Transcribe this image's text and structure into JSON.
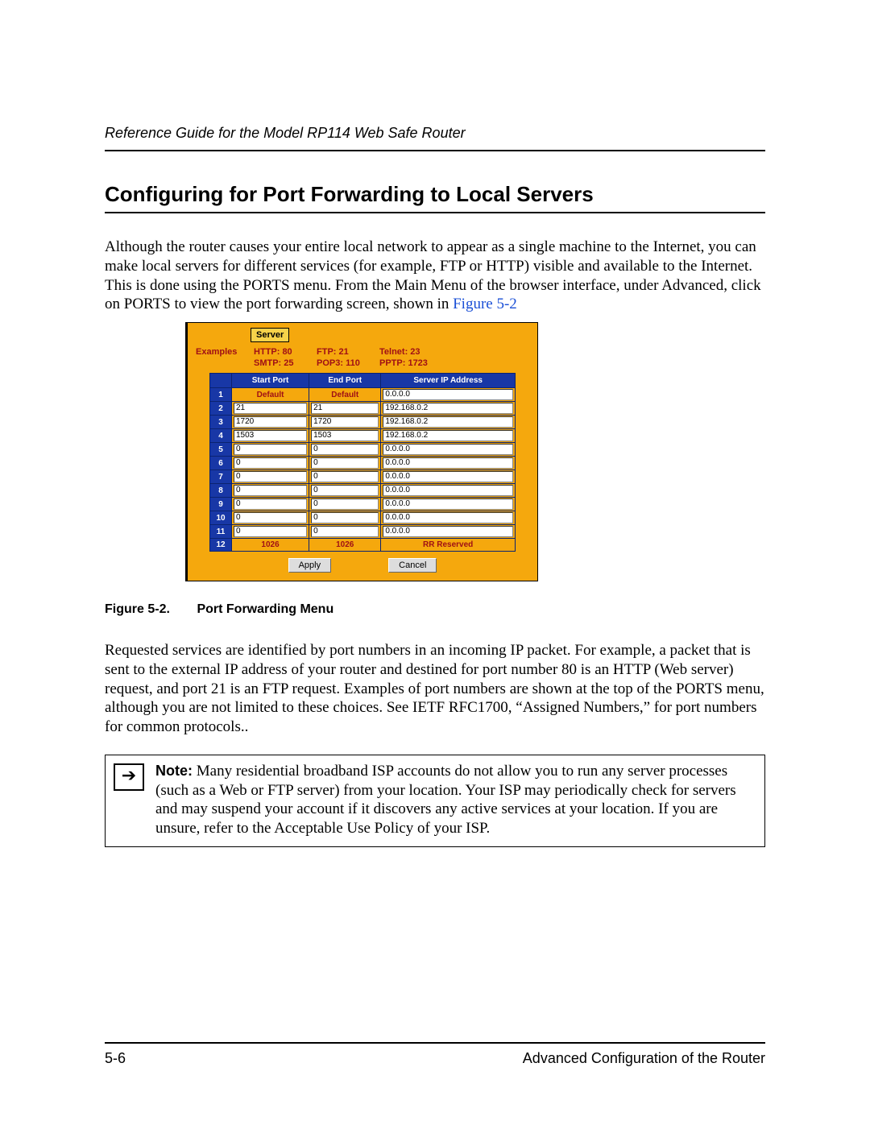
{
  "running_head": "Reference Guide for the Model RP114 Web Safe Router",
  "section_title": "Configuring for Port Forwarding to Local Servers",
  "para1": "Although the router causes your entire local network to appear as a single machine to the Internet, you can make local servers for different services (for example, FTP or HTTP) visible and available to the Internet. This is done using the PORTS menu. From the Main Menu of the browser interface, under Advanced, click on PORTS to view the port forwarding screen, shown in ",
  "fig_ref": "Figure 5-2",
  "shot": {
    "server_label": "Server",
    "examples_label": "Examples",
    "ex": {
      "r1c1": "HTTP: 80",
      "r1c2": "FTP: 21",
      "r1c3": "Telnet: 23",
      "r2c1": "SMTP: 25",
      "r2c2": "POP3: 110",
      "r2c3": "PPTP: 1723"
    },
    "headers": {
      "start": "Start Port",
      "end": "End Port",
      "ip": "Server IP Address"
    },
    "rows": [
      {
        "n": "1",
        "start": "Default",
        "end": "Default",
        "ip": "0.0.0.0",
        "type": "default"
      },
      {
        "n": "2",
        "start": "21",
        "end": "21",
        "ip": "192.168.0.2",
        "type": "input"
      },
      {
        "n": "3",
        "start": "1720",
        "end": "1720",
        "ip": "192.168.0.2",
        "type": "input"
      },
      {
        "n": "4",
        "start": "1503",
        "end": "1503",
        "ip": "192.168.0.2",
        "type": "input"
      },
      {
        "n": "5",
        "start": "0",
        "end": "0",
        "ip": "0.0.0.0",
        "type": "input"
      },
      {
        "n": "6",
        "start": "0",
        "end": "0",
        "ip": "0.0.0.0",
        "type": "input"
      },
      {
        "n": "7",
        "start": "0",
        "end": "0",
        "ip": "0.0.0.0",
        "type": "input"
      },
      {
        "n": "8",
        "start": "0",
        "end": "0",
        "ip": "0.0.0.0",
        "type": "input"
      },
      {
        "n": "9",
        "start": "0",
        "end": "0",
        "ip": "0.0.0.0",
        "type": "input"
      },
      {
        "n": "10",
        "start": "0",
        "end": "0",
        "ip": "0.0.0.0",
        "type": "input"
      },
      {
        "n": "11",
        "start": "0",
        "end": "0",
        "ip": "0.0.0.0",
        "type": "input"
      },
      {
        "n": "12",
        "start": "1026",
        "end": "1026",
        "ip": "RR Reserved",
        "type": "reserved"
      }
    ],
    "apply": "Apply",
    "cancel": "Cancel"
  },
  "caption_num": "Figure 5-2.",
  "caption_text": "Port Forwarding Menu",
  "para2": "Requested services are identified by port numbers in an incoming IP packet. For example, a packet that is sent to the external IP address of your router and destined for port number 80 is an HTTP (Web server) request, and port 21 is an FTP request. Examples of port numbers are shown at the top of the PORTS menu, although you are not limited to these choices. See IETF RFC1700, “Assigned Numbers,” for port numbers for common protocols..",
  "note_label": "Note:",
  "note_body": " Many residential broadband ISP accounts do not allow you to run any server processes (such as a Web or FTP server) from your location. Your ISP may periodically check for servers and may suspend your account if it discovers any active services at your location. If you are unsure, refer to the Acceptable Use Policy of your ISP.",
  "note_arrow": "➔",
  "footer_left": "5-6",
  "footer_right": "Advanced Configuration of the Router"
}
